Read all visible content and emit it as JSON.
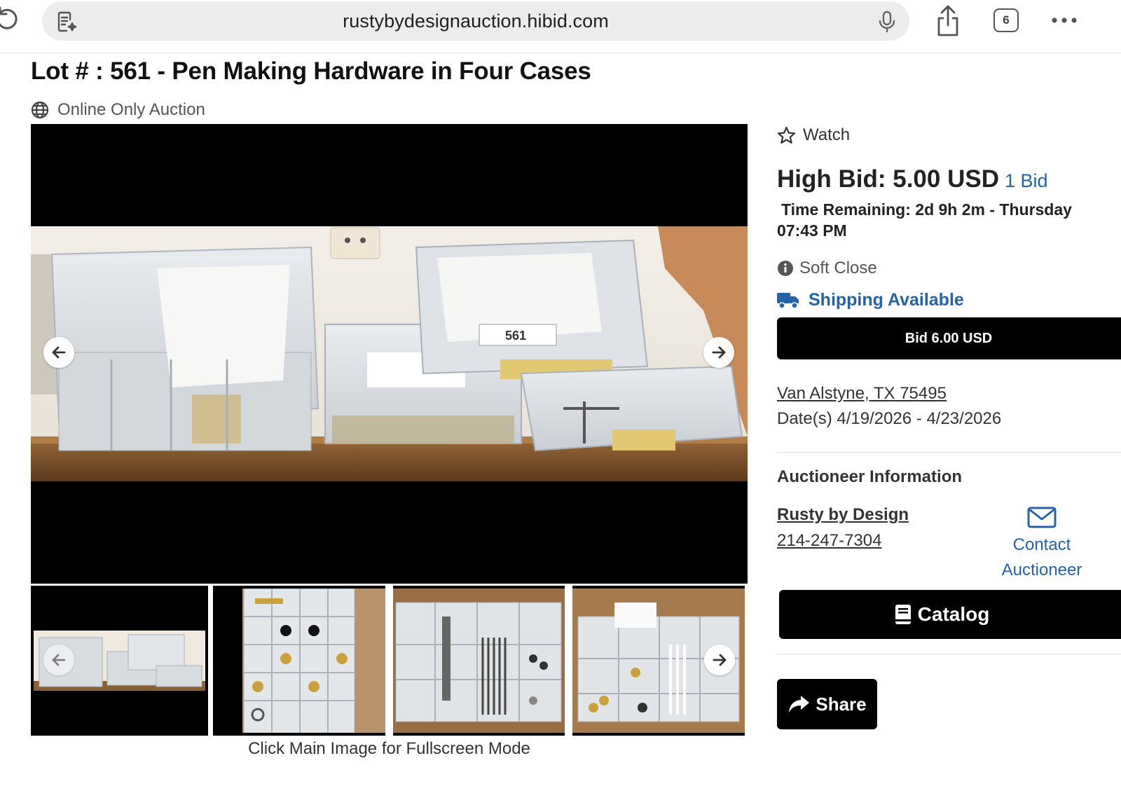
{
  "browser": {
    "url": "rustybydesignauction.hibid.com",
    "tab_count": "6",
    "icons": [
      "reload-icon",
      "reader-icon",
      "microphone-icon",
      "share-icon",
      "tabs-icon",
      "more-icon"
    ]
  },
  "lot": {
    "title": "Lot # : 561 - Pen Making Hardware in Four Cases",
    "auction_type": "Online Only Auction"
  },
  "gallery": {
    "caption": "Click Main Image for Fullscreen Mode",
    "thumbnail_count": 4
  },
  "bidding": {
    "watch_label": "Watch",
    "high_bid_label": "High Bid: 5.00 USD",
    "bid_count": "1 Bid",
    "time_remaining_line1": "Time Remaining: 2d 9h 2m - Thursday",
    "time_remaining_line2": "07:43 PM",
    "soft_close": "Soft Close",
    "shipping": "Shipping Available",
    "bid_button": "Bid 6.00 USD"
  },
  "details": {
    "location": "Van Alstyne, TX 75495",
    "dates": "Date(s) 4/19/2026 - 4/23/2026"
  },
  "auctioneer": {
    "heading": "Auctioneer Information",
    "name": "Rusty by Design",
    "phone": "214-247-7304",
    "contact_line1": "Contact",
    "contact_line2": "Auctioneer"
  },
  "actions": {
    "catalog": "Catalog",
    "share": "Share"
  },
  "colors": {
    "accent_blue": "#2463a7",
    "button_black": "#000000",
    "urlbar_gray": "#ececee"
  }
}
